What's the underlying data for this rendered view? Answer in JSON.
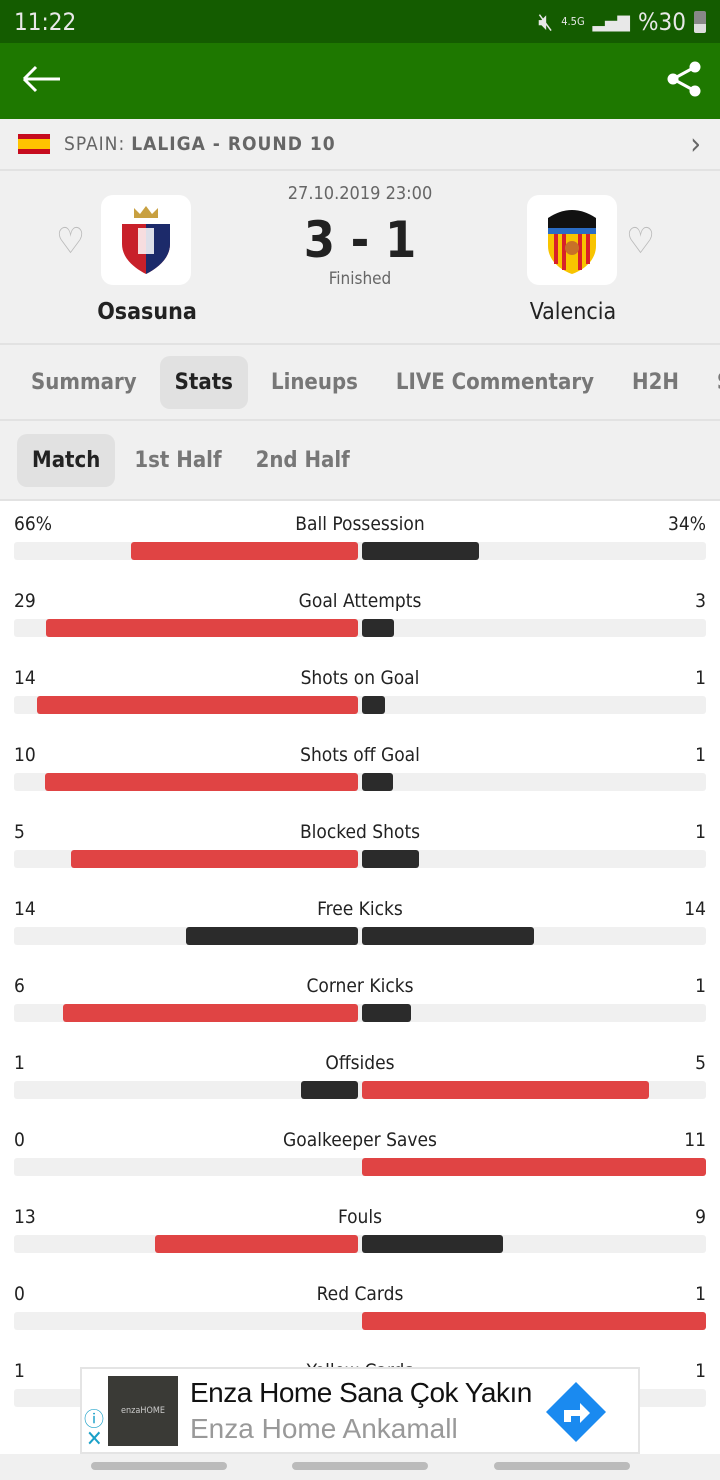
{
  "status_bar": {
    "time": "11:22",
    "network": "4.5G",
    "battery": "%30"
  },
  "app_bar": {
    "back_icon": "arrow-left-icon",
    "share_icon": "share-icon"
  },
  "league": {
    "country": "SPAIN:",
    "name": "LALIGA - ROUND 10"
  },
  "match": {
    "date": "27.10.2019 23:00",
    "score": "3 - 1",
    "status": "Finished",
    "home": "Osasuna",
    "away": "Valencia"
  },
  "tabs": [
    "Summary",
    "Stats",
    "Lineups",
    "LIVE Commentary",
    "H2H",
    "S"
  ],
  "active_tab": "Stats",
  "period_tabs": [
    "Match",
    "1st Half",
    "2nd Half"
  ],
  "active_period": "Match",
  "colors": {
    "leader": "#e04444",
    "other": "#2b2b2b",
    "header": "#1e7800"
  },
  "stats": [
    {
      "label": "Ball Possession",
      "home": "66%",
      "away": "34%",
      "hv": 66,
      "av": 34
    },
    {
      "label": "Goal Attempts",
      "home": "29",
      "away": "3",
      "hv": 29,
      "av": 3
    },
    {
      "label": "Shots on Goal",
      "home": "14",
      "away": "1",
      "hv": 14,
      "av": 1
    },
    {
      "label": "Shots off Goal",
      "home": "10",
      "away": "1",
      "hv": 10,
      "av": 1
    },
    {
      "label": "Blocked Shots",
      "home": "5",
      "away": "1",
      "hv": 5,
      "av": 1
    },
    {
      "label": "Free Kicks",
      "home": "14",
      "away": "14",
      "hv": 14,
      "av": 14
    },
    {
      "label": "Corner Kicks",
      "home": "6",
      "away": "1",
      "hv": 6,
      "av": 1
    },
    {
      "label": "Offsides",
      "home": "1",
      "away": "5",
      "hv": 1,
      "av": 5
    },
    {
      "label": "Goalkeeper Saves",
      "home": "0",
      "away": "11",
      "hv": 0,
      "av": 11
    },
    {
      "label": "Fouls",
      "home": "13",
      "away": "9",
      "hv": 13,
      "av": 9
    },
    {
      "label": "Red Cards",
      "home": "0",
      "away": "1",
      "hv": 0,
      "av": 1
    },
    {
      "label": "Yellow Cards",
      "home": "1",
      "away": "1",
      "hv": 1,
      "av": 1
    }
  ],
  "ad": {
    "title": "Enza Home Sana Çok Yakın",
    "subtitle": "Enza Home Ankamall",
    "brand": "enzaHOME"
  }
}
